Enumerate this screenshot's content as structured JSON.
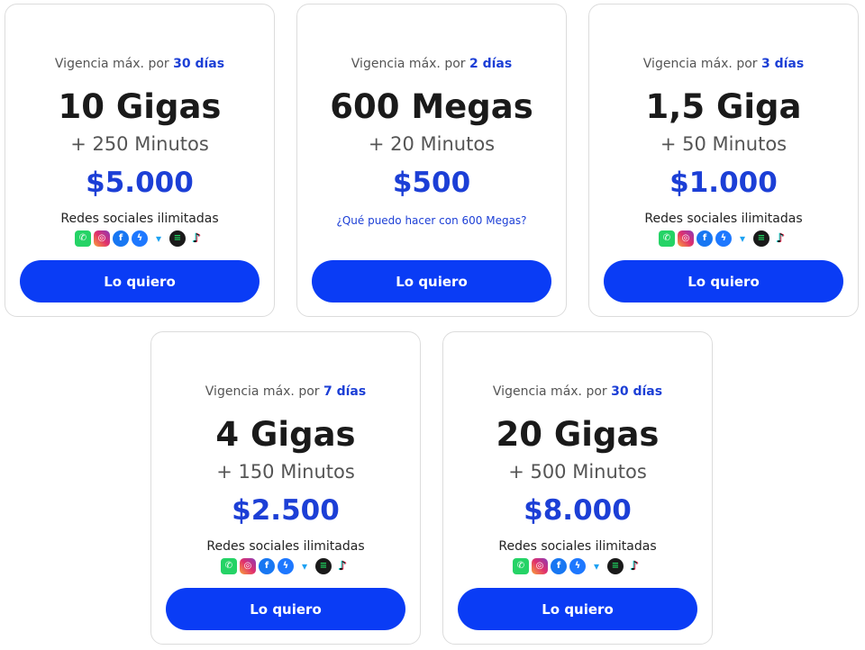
{
  "plans": [
    {
      "validity_prefix": "Vigencia máx. por",
      "validity_days": "30 días",
      "title": "10 Gigas",
      "minutes": "+ 250 Minutos",
      "price": "$5.000",
      "social_label": "Redes sociales ilimitadas",
      "cta": "Lo quiero"
    },
    {
      "validity_prefix": "Vigencia máx. por",
      "validity_days": "2 días",
      "title": "600 Megas",
      "minutes": "+ 20 Minutos",
      "price": "$500",
      "info_link": "¿Qué puedo hacer con 600 Megas?",
      "cta": "Lo quiero"
    },
    {
      "validity_prefix": "Vigencia máx. por",
      "validity_days": "3 días",
      "title": "1,5 Giga",
      "minutes": "+ 50 Minutos",
      "price": "$1.000",
      "social_label": "Redes sociales ilimitadas",
      "cta": "Lo quiero"
    },
    {
      "validity_prefix": "Vigencia máx. por",
      "validity_days": "7 días",
      "title": "4 Gigas",
      "minutes": "+ 150 Minutos",
      "price": "$2.500",
      "social_label": "Redes sociales ilimitadas",
      "cta": "Lo quiero"
    },
    {
      "validity_prefix": "Vigencia máx. por",
      "validity_days": "30 días",
      "title": "20 Gigas",
      "minutes": "+ 500 Minutos",
      "price": "$8.000",
      "social_label": "Redes sociales ilimitadas",
      "cta": "Lo quiero"
    }
  ],
  "social_icons": [
    "whatsapp-icon",
    "instagram-icon",
    "facebook-icon",
    "messenger-icon",
    "twitter-icon",
    "spotify-icon",
    "tiktok-icon"
  ],
  "colors": {
    "accent": "#1c3fd6",
    "button": "#0a3cf5",
    "title": "#1a1a1a",
    "muted": "#555555",
    "border": "#dcdcdc"
  }
}
